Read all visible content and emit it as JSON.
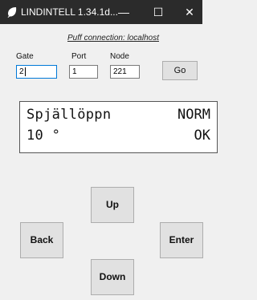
{
  "window": {
    "title": "LINDINTELL 1.34.1d...",
    "minimize_glyph": "—",
    "maximize_glyph": "☐",
    "close_glyph": "✕",
    "app_icon": "leaf-icon",
    "titlebar_color": "#2b2b2b"
  },
  "connection": {
    "text": "Puff connection: localhost"
  },
  "fields": {
    "gate_label": "Gate",
    "port_label": "Port",
    "node_label": "Node",
    "gate_value": "2",
    "port_value": "1",
    "node_value": "221"
  },
  "buttons": {
    "go": "Go",
    "up": "Up",
    "back": "Back",
    "enter": "Enter",
    "down": "Down"
  },
  "display": {
    "line1_left": "Spjällöppn",
    "line1_right": "NORM",
    "line2_left": "10 °",
    "line2_right": "OK"
  }
}
